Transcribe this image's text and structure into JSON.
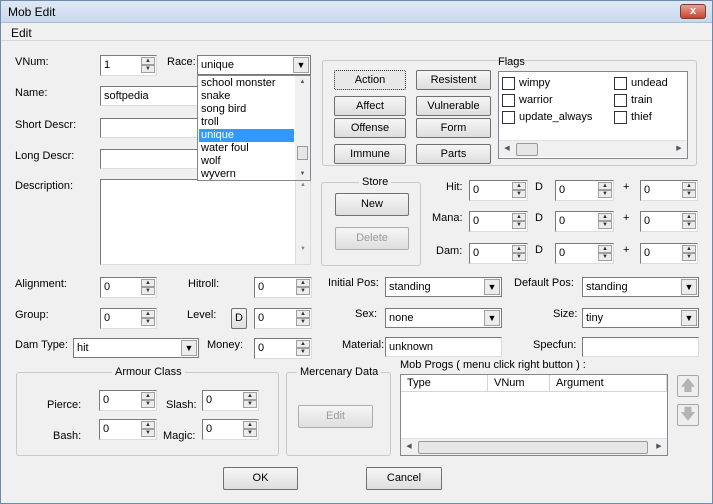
{
  "window": {
    "title": "Mob Edit",
    "close_glyph": "x"
  },
  "menu": {
    "edit": "Edit"
  },
  "fields": {
    "vnum_label": "VNum:",
    "vnum_value": "1",
    "race_label": "Race:",
    "race_value": "unique",
    "name_label": "Name:",
    "name_value": "softpedia",
    "short_label": "Short Descr:",
    "short_value": "",
    "long_label": "Long Descr:",
    "long_value": "",
    "desc_label": "Description:",
    "desc_value": ""
  },
  "race_dropdown": {
    "options": [
      "school monster",
      "snake",
      "song bird",
      "troll",
      "unique",
      "water foul",
      "wolf",
      "wyvern"
    ],
    "selected": "unique"
  },
  "action_buttons": [
    "Action",
    "Affect",
    "Offense",
    "Immune"
  ],
  "right_buttons": [
    "Resistent",
    "Vulnerable",
    "Form",
    "Parts"
  ],
  "flags": {
    "label": "Flags",
    "col1": [
      "wimpy",
      "warrior",
      "update_always"
    ],
    "col2": [
      "undead",
      "train",
      "thief"
    ]
  },
  "store": {
    "label": "Store",
    "new": "New",
    "delete": "Delete"
  },
  "dice": {
    "hit_label": "Hit:",
    "mana_label": "Mana:",
    "dam_label": "Dam:",
    "d": "D",
    "plus": "+",
    "hit": [
      "0",
      "0",
      "0"
    ],
    "mana": [
      "0",
      "0",
      "0"
    ],
    "dam": [
      "0",
      "0",
      "0"
    ]
  },
  "stats": {
    "alignment_label": "Alignment:",
    "alignment": "0",
    "hitroll_label": "Hitroll:",
    "hitroll": "0",
    "group_label": "Group:",
    "group": "0",
    "level_label": "Level:",
    "level_btn": "D",
    "level": "0",
    "damtype_label": "Dam Type:",
    "damtype": "hit",
    "money_label": "Money:",
    "money": "0",
    "initpos_label": "Initial Pos:",
    "initpos": "standing",
    "defpos_label": "Default Pos:",
    "defpos": "standing",
    "sex_label": "Sex:",
    "sex": "none",
    "size_label": "Size:",
    "size": "tiny",
    "material_label": "Material:",
    "material": "unknown",
    "specfun_label": "Specfun:",
    "specfun": ""
  },
  "armour": {
    "label": "Armour Class",
    "pierce_label": "Pierce:",
    "pierce": "0",
    "slash_label": "Slash:",
    "slash": "0",
    "bash_label": "Bash:",
    "bash": "0",
    "magic_label": "Magic:",
    "magic": "0"
  },
  "mercenary": {
    "label": "Mercenary Data",
    "edit": "Edit"
  },
  "mobprogs": {
    "label": "Mob Progs ( menu click right button ) :",
    "columns": [
      "Type",
      "VNum",
      "Argument"
    ]
  },
  "footer": {
    "ok": "OK",
    "cancel": "Cancel"
  },
  "colors": {
    "selection": "#3399ff",
    "window_bg": "#f0f0f0"
  }
}
